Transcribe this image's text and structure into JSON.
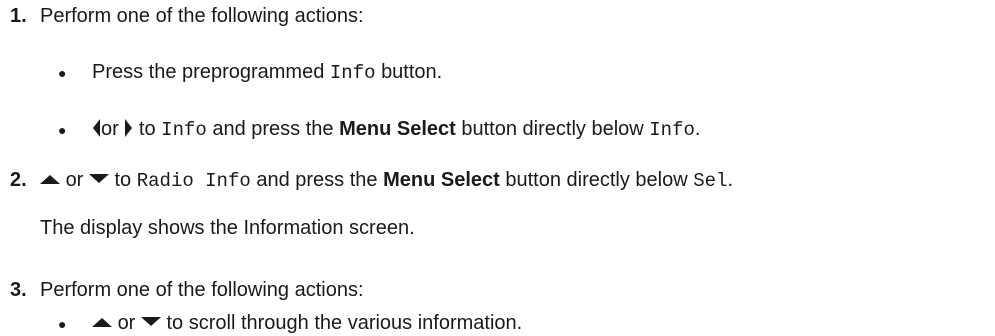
{
  "step1": {
    "number": "1.",
    "text": "Perform one of the following actions:",
    "bullets": {
      "a": {
        "pre": "Press the preprogrammed",
        "code": "Info",
        "post": "button."
      },
      "b": {
        "left_icon": "left-arrow-icon",
        "or": "or",
        "right_icon": "right-arrow-icon",
        "to": "to",
        "code1": "Info",
        "mid": "and press the",
        "bold": "Menu Select",
        "post": "button directly below",
        "code2": "Info",
        "end": "."
      }
    }
  },
  "step2": {
    "number": "2.",
    "up_icon": "up-arrow-icon",
    "or": "or",
    "down_icon": "down-arrow-icon",
    "to": "to",
    "code1": "Radio Info",
    "mid": "and press the",
    "bold": "Menu Select",
    "post": "button directly below",
    "code2": "Sel",
    "end": ".",
    "result": "The display shows the Information screen."
  },
  "step3": {
    "number": "3.",
    "text": "Perform one of the following actions:",
    "bullets": {
      "a": {
        "up_icon": "up-arrow-icon",
        "or": "or",
        "down_icon": "down-arrow-icon",
        "post": "to scroll through the various information."
      }
    }
  }
}
